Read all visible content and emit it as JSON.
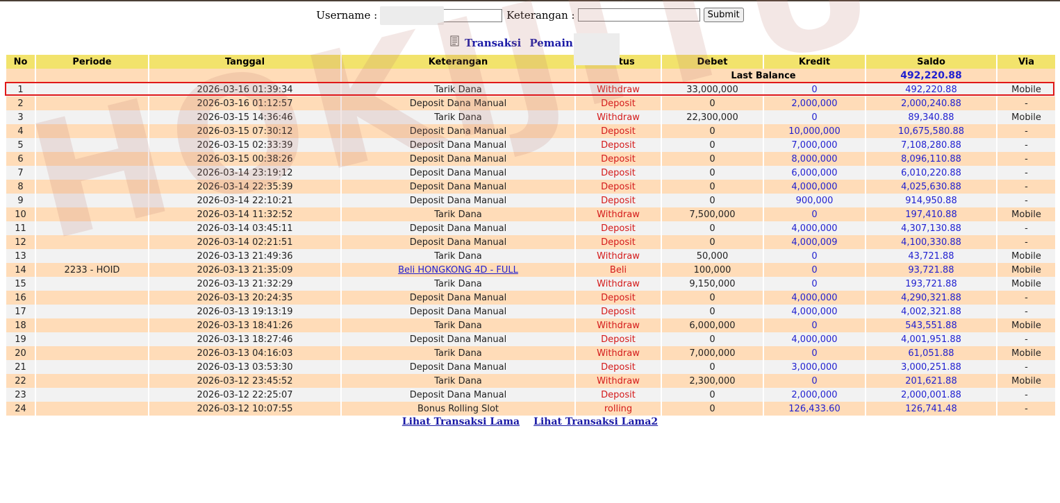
{
  "form": {
    "username_label": "Username :",
    "username_value": "",
    "keterangan_label": "Keterangan :",
    "keterangan_value": "",
    "submit_label": "Submit"
  },
  "header": {
    "title": "Transaksi",
    "pemain_label": "Pemain : a"
  },
  "watermark": "HOKIJITU",
  "table": {
    "columns": [
      "No",
      "Periode",
      "Tanggal",
      "Keterangan",
      "Status",
      "Debet",
      "Kredit",
      "Saldo",
      "Via"
    ],
    "last_balance_label": "Last Balance",
    "last_balance_value": "492,220.88",
    "rows": [
      {
        "no": "1",
        "periode": "",
        "tanggal": "2026-03-16 01:39:34",
        "keterangan": "Tarik Dana",
        "status": "Withdraw",
        "debet": "33,000,000",
        "kredit": "0",
        "saldo": "492,220.88",
        "via": "Mobile"
      },
      {
        "no": "2",
        "periode": "",
        "tanggal": "2026-03-16 01:12:57",
        "keterangan": "Deposit Dana Manual",
        "status": "Deposit",
        "debet": "0",
        "kredit": "2,000,000",
        "saldo": "2,000,240.88",
        "via": "-"
      },
      {
        "no": "3",
        "periode": "",
        "tanggal": "2026-03-15 14:36:46",
        "keterangan": "Tarik Dana",
        "status": "Withdraw",
        "debet": "22,300,000",
        "kredit": "0",
        "saldo": "89,340.88",
        "via": "Mobile"
      },
      {
        "no": "4",
        "periode": "",
        "tanggal": "2026-03-15 07:30:12",
        "keterangan": "Deposit Dana Manual",
        "status": "Deposit",
        "debet": "0",
        "kredit": "10,000,000",
        "saldo": "10,675,580.88",
        "via": "-"
      },
      {
        "no": "5",
        "periode": "",
        "tanggal": "2026-03-15 02:33:39",
        "keterangan": "Deposit Dana Manual",
        "status": "Deposit",
        "debet": "0",
        "kredit": "7,000,000",
        "saldo": "7,108,280.88",
        "via": "-"
      },
      {
        "no": "6",
        "periode": "",
        "tanggal": "2026-03-15 00:38:26",
        "keterangan": "Deposit Dana Manual",
        "status": "Deposit",
        "debet": "0",
        "kredit": "8,000,000",
        "saldo": "8,096,110.88",
        "via": "-"
      },
      {
        "no": "7",
        "periode": "",
        "tanggal": "2026-03-14 23:19:12",
        "keterangan": "Deposit Dana Manual",
        "status": "Deposit",
        "debet": "0",
        "kredit": "6,000,000",
        "saldo": "6,010,220.88",
        "via": "-"
      },
      {
        "no": "8",
        "periode": "",
        "tanggal": "2026-03-14 22:35:39",
        "keterangan": "Deposit Dana Manual",
        "status": "Deposit",
        "debet": "0",
        "kredit": "4,000,000",
        "saldo": "4,025,630.88",
        "via": "-"
      },
      {
        "no": "9",
        "periode": "",
        "tanggal": "2026-03-14 22:10:21",
        "keterangan": "Deposit Dana Manual",
        "status": "Deposit",
        "debet": "0",
        "kredit": "900,000",
        "saldo": "914,950.88",
        "via": "-"
      },
      {
        "no": "10",
        "periode": "",
        "tanggal": "2026-03-14 11:32:52",
        "keterangan": "Tarik Dana",
        "status": "Withdraw",
        "debet": "7,500,000",
        "kredit": "0",
        "saldo": "197,410.88",
        "via": "Mobile"
      },
      {
        "no": "11",
        "periode": "",
        "tanggal": "2026-03-14 03:45:11",
        "keterangan": "Deposit Dana Manual",
        "status": "Deposit",
        "debet": "0",
        "kredit": "4,000,000",
        "saldo": "4,307,130.88",
        "via": "-"
      },
      {
        "no": "12",
        "periode": "",
        "tanggal": "2026-03-14 02:21:51",
        "keterangan": "Deposit Dana Manual",
        "status": "Deposit",
        "debet": "0",
        "kredit": "4,000,009",
        "saldo": "4,100,330.88",
        "via": "-"
      },
      {
        "no": "13",
        "periode": "",
        "tanggal": "2026-03-13 21:49:36",
        "keterangan": "Tarik Dana",
        "status": "Withdraw",
        "debet": "50,000",
        "kredit": "0",
        "saldo": "43,721.88",
        "via": "Mobile"
      },
      {
        "no": "14",
        "periode": "2233 - HOID",
        "tanggal": "2026-03-13 21:35:09",
        "keterangan": "Beli HONGKONG 4D - FULL",
        "status": "Beli",
        "debet": "100,000",
        "kredit": "0",
        "saldo": "93,721.88",
        "via": "Mobile",
        "link": true
      },
      {
        "no": "15",
        "periode": "",
        "tanggal": "2026-03-13 21:32:29",
        "keterangan": "Tarik Dana",
        "status": "Withdraw",
        "debet": "9,150,000",
        "kredit": "0",
        "saldo": "193,721.88",
        "via": "Mobile"
      },
      {
        "no": "16",
        "periode": "",
        "tanggal": "2026-03-13 20:24:35",
        "keterangan": "Deposit Dana Manual",
        "status": "Deposit",
        "debet": "0",
        "kredit": "4,000,000",
        "saldo": "4,290,321.88",
        "via": "-"
      },
      {
        "no": "17",
        "periode": "",
        "tanggal": "2026-03-13 19:13:19",
        "keterangan": "Deposit Dana Manual",
        "status": "Deposit",
        "debet": "0",
        "kredit": "4,000,000",
        "saldo": "4,002,321.88",
        "via": "-"
      },
      {
        "no": "18",
        "periode": "",
        "tanggal": "2026-03-13 18:41:26",
        "keterangan": "Tarik Dana",
        "status": "Withdraw",
        "debet": "6,000,000",
        "kredit": "0",
        "saldo": "543,551.88",
        "via": "Mobile"
      },
      {
        "no": "19",
        "periode": "",
        "tanggal": "2026-03-13 18:27:46",
        "keterangan": "Deposit Dana Manual",
        "status": "Deposit",
        "debet": "0",
        "kredit": "4,000,000",
        "saldo": "4,001,951.88",
        "via": "-"
      },
      {
        "no": "20",
        "periode": "",
        "tanggal": "2026-03-13 04:16:03",
        "keterangan": "Tarik Dana",
        "status": "Withdraw",
        "debet": "7,000,000",
        "kredit": "0",
        "saldo": "61,051.88",
        "via": "Mobile"
      },
      {
        "no": "21",
        "periode": "",
        "tanggal": "2026-03-13 03:53:30",
        "keterangan": "Deposit Dana Manual",
        "status": "Deposit",
        "debet": "0",
        "kredit": "3,000,000",
        "saldo": "3,000,251.88",
        "via": "-"
      },
      {
        "no": "22",
        "periode": "",
        "tanggal": "2026-03-12 23:45:52",
        "keterangan": "Tarik Dana",
        "status": "Withdraw",
        "debet": "2,300,000",
        "kredit": "0",
        "saldo": "201,621.88",
        "via": "Mobile"
      },
      {
        "no": "23",
        "periode": "",
        "tanggal": "2026-03-12 22:25:07",
        "keterangan": "Deposit Dana Manual",
        "status": "Deposit",
        "debet": "0",
        "kredit": "2,000,000",
        "saldo": "2,000,001.88",
        "via": "-"
      },
      {
        "no": "24",
        "periode": "",
        "tanggal": "2026-03-12 10:07:55",
        "keterangan": "Bonus Rolling Slot",
        "status": "rolling",
        "debet": "0",
        "kredit": "126,433.60",
        "saldo": "126,741.48",
        "via": "-"
      }
    ]
  },
  "links": {
    "old_transactions": "Lihat Transaksi Lama",
    "old_transactions2": "Lihat Transaksi Lama2"
  },
  "colors": {
    "header_bg": "#f2e36c",
    "row_odd": "#ffdcb8",
    "row_even": "#f2f2f2",
    "status_red": "#d41a1a",
    "value_blue": "#1f1fd0",
    "highlight": "#e01818"
  }
}
